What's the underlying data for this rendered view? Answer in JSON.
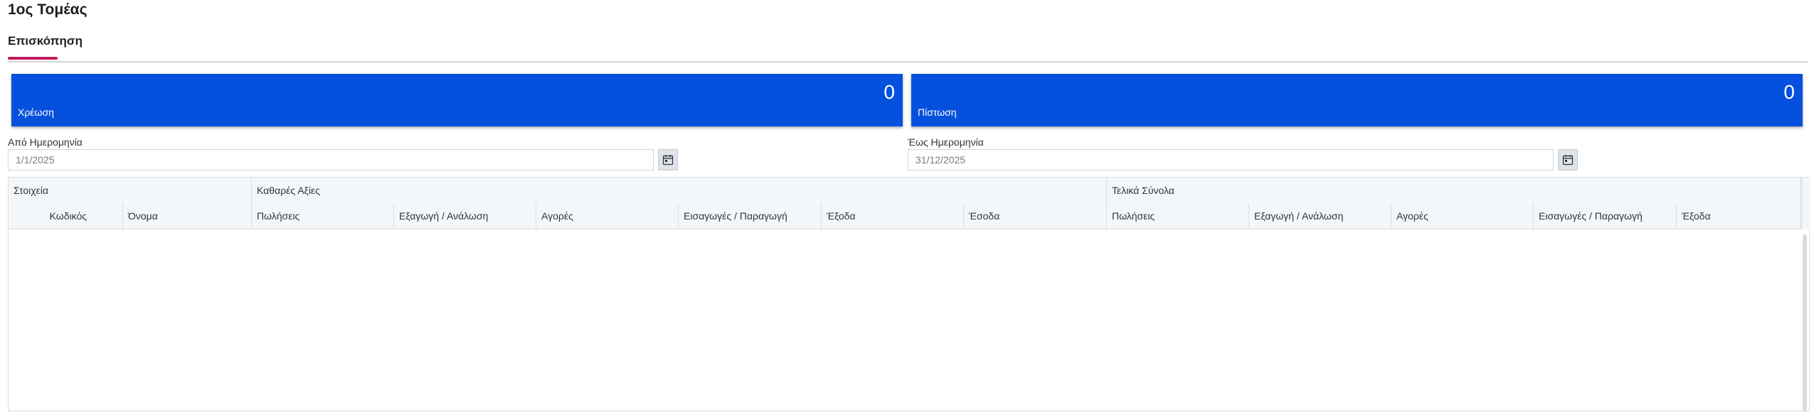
{
  "page": {
    "title": "1ος Τομέας"
  },
  "tabs": [
    {
      "label": "Επισκόπηση",
      "active": true
    }
  ],
  "cards": {
    "debit": {
      "value": "0",
      "label": "Χρέωση"
    },
    "credit": {
      "value": "0",
      "label": "Πίστωση"
    },
    "color": "#0551dd"
  },
  "filters": {
    "from": {
      "label": "Από Ημερομηνία",
      "value": "1/1/2025",
      "icon": "calendar-icon"
    },
    "to": {
      "label": "Έως Ημερομηνία",
      "value": "31/12/2025",
      "icon": "calendar-icon"
    }
  },
  "grid": {
    "groups": [
      "Στοιχεία",
      "Καθαρές Αξίες",
      "Τελικά Σύνολα"
    ],
    "columns": [
      "Κωδικός",
      "Όνομα",
      "Πωλήσεις",
      "Εξαγωγή / Ανάλωση",
      "Αγορές",
      "Εισαγωγές / Παραγωγή",
      "Έξοδα",
      "Έσοδα",
      "Πωλήσεις",
      "Εξαγωγή / Ανάλωση",
      "Αγορές",
      "Εισαγωγές / Παραγωγή",
      "Έξοδα"
    ],
    "rows": []
  },
  "accent_color": "#c2185b"
}
